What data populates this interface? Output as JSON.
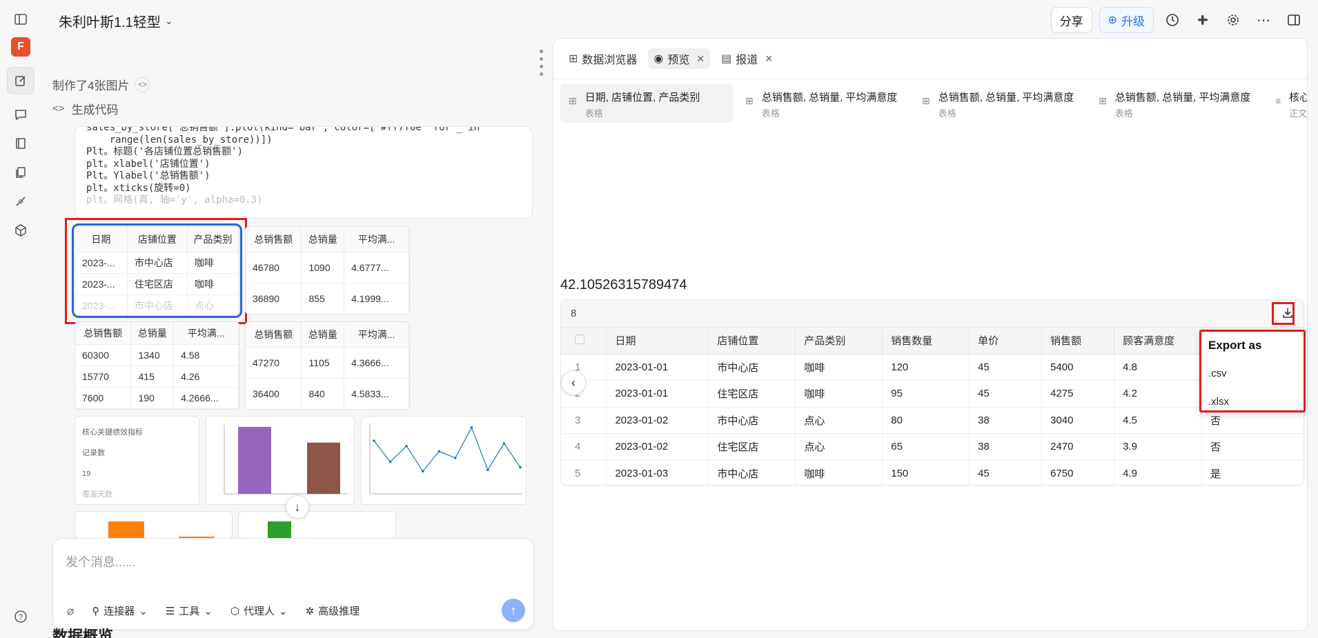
{
  "app": {
    "title": "朱利叶斯1.1轻型",
    "avatar_letter": "F"
  },
  "topbar": {
    "share_label": "分享",
    "upgrade_label": "升级"
  },
  "chat": {
    "made_images": "制作了4张图片",
    "generate_code": "生成代码",
    "code_lines": [
      "sales_by_store['总销售额'].plot(kind='bar', color=['#ff7f0e' for _ in",
      "    range(len(sales_by_store))])",
      "Plt。标题('各店铺位置总销售额')",
      "plt。xlabel('店铺位置')",
      "Plt。Ylabel('总销售额')",
      "plt。xticks(旋转=0)",
      "plt。网格(真, 轴='y', alpha=0.3)"
    ],
    "table1": {
      "headers": [
        "日期",
        "店铺位置",
        "产品类别"
      ],
      "rows": [
        [
          "2023-...",
          "市中心店",
          "咖啡"
        ],
        [
          "2023-...",
          "住宅区店",
          "咖啡"
        ],
        [
          "2023-...",
          "市中心店",
          "点心"
        ]
      ]
    },
    "table2": {
      "headers": [
        "总销售额",
        "总销量",
        "平均满..."
      ],
      "rows": [
        [
          "46780",
          "1090",
          "4.6777..."
        ],
        [
          "36890",
          "855",
          "4.1999..."
        ]
      ]
    },
    "table3": {
      "headers": [
        "总销售额",
        "总销量",
        "平均满..."
      ],
      "rows": [
        [
          "60300",
          "1340",
          "4.58"
        ],
        [
          "15770",
          "415",
          "4.26"
        ],
        [
          "7600",
          "190",
          "4.2666..."
        ]
      ]
    },
    "table4": {
      "headers": [
        "总销售额",
        "总销量",
        "平均满..."
      ],
      "rows": [
        [
          "47270",
          "1105",
          "4.3666..."
        ],
        [
          "36400",
          "840",
          "4.5833..."
        ]
      ]
    },
    "kpi_card": {
      "title": "核心关键绩效指标",
      "line1": "记录数",
      "line2": "19",
      "line3": "覆盖天数"
    },
    "bar_chart1": {
      "values": [
        68000,
        52000
      ],
      "colors": [
        "#9467bd",
        "#8c564b"
      ]
    },
    "line_chart": {
      "values": [
        3.8,
        2.2,
        3.4,
        1.5,
        3.0,
        2.5,
        4.8,
        1.6,
        3.6,
        1.8
      ]
    },
    "bar_chart2": {
      "colors": [
        "#ff7f0e"
      ]
    },
    "bar_chart3": {
      "colors": [
        "#2ca02c"
      ]
    },
    "composer_placeholder": "发个消息......",
    "tools": [
      "连接器",
      "工具",
      "代理人",
      "高级推理"
    ],
    "below_text": "数据概览"
  },
  "panel": {
    "tabs": [
      {
        "label": "数据浏览器"
      },
      {
        "label": "预览"
      },
      {
        "label": "报道"
      }
    ],
    "outputs": [
      {
        "title": "日期, 店铺位置, 产品类别",
        "sub": "表格"
      },
      {
        "title": "总销售额, 总销量, 平均满意度",
        "sub": "表格"
      },
      {
        "title": "总销售额, 总销量, 平均满意度",
        "sub": "表格"
      },
      {
        "title": "总销售额, 总销量, 平均满意度",
        "sub": "表格"
      },
      {
        "title": "核心KP",
        "sub": "正文"
      }
    ],
    "big_number": "42.10526315789474",
    "grid_count": "8",
    "columns": [
      "日期",
      "店铺位置",
      "产品类别",
      "销售数量",
      "单价",
      "销售额",
      "顾客满意度",
      ""
    ],
    "rows": [
      [
        "1",
        "2023-01-01",
        "市中心店",
        "咖啡",
        "120",
        "45",
        "5400",
        "4.8",
        ""
      ],
      [
        "2",
        "2023-01-01",
        "住宅区店",
        "咖啡",
        "95",
        "45",
        "4275",
        "4.2",
        ""
      ],
      [
        "3",
        "2023-01-02",
        "市中心店",
        "点心",
        "80",
        "38",
        "3040",
        "4.5",
        "否"
      ],
      [
        "4",
        "2023-01-02",
        "住宅区店",
        "点心",
        "65",
        "38",
        "2470",
        "3.9",
        "否"
      ],
      [
        "5",
        "2023-01-03",
        "市中心店",
        "咖啡",
        "150",
        "45",
        "6750",
        "4.9",
        "是"
      ]
    ],
    "export_menu": {
      "title": "Export as",
      "options": [
        ".csv",
        ".xlsx"
      ]
    }
  }
}
